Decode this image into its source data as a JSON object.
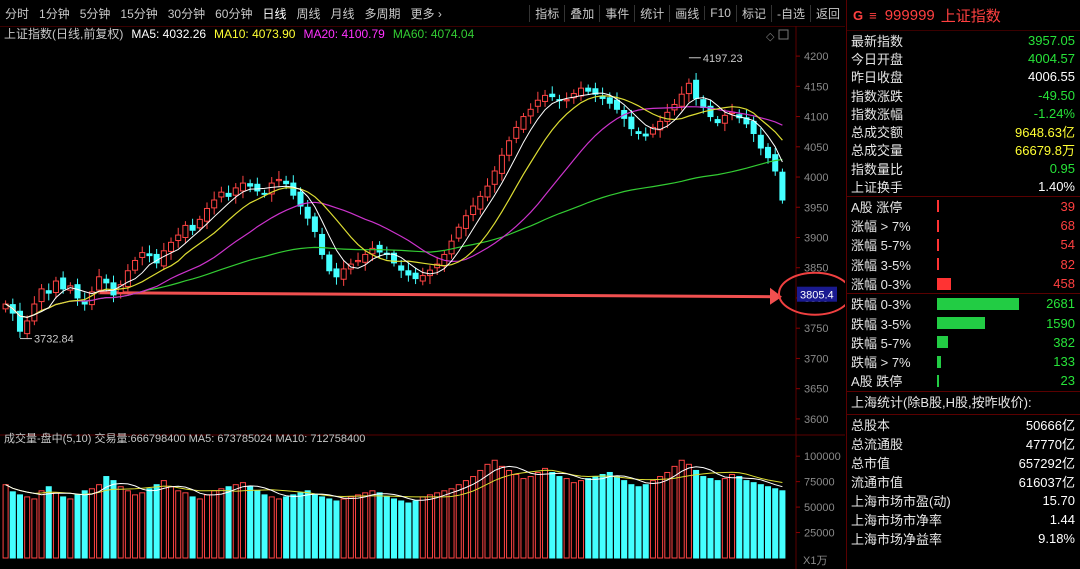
{
  "toolbar": {
    "left": [
      "分时",
      "1分钟",
      "5分钟",
      "15分钟",
      "30分钟",
      "60分钟",
      "日线",
      "周线",
      "月线",
      "多周期",
      "更多 ›"
    ],
    "active_index": 6,
    "right": [
      "指标",
      "叠加",
      "事件",
      "统计",
      "画线",
      "F10",
      "标记",
      "-自选",
      "返回"
    ]
  },
  "indicator_header": {
    "label": "上证指数(日线,前复权)",
    "ma5": "MA5: 4032.26",
    "ma10": "MA10: 4073.90",
    "ma20": "MA20: 4100.79",
    "ma60": "MA60: 4074.04",
    "colors": {
      "ma5": "#ffffff",
      "ma10": "#ffff33",
      "ma20": "#ff33ff",
      "ma60": "#33cc33"
    }
  },
  "volume_header": "成交量-盘中(5,10) 交易量:666798400 MA5: 673785024 MA10: 712758400",
  "price_ticks": [
    "4200",
    "4150",
    "4100",
    "4050",
    "4000",
    "3950",
    "3900",
    "3850",
    "3800",
    "3750",
    "3700",
    "3650",
    "3600"
  ],
  "volume_ticks": [
    "100000",
    "75000",
    "50000",
    "25000"
  ],
  "volume_unit": "X1万",
  "annotations": {
    "high_label": "4197.23",
    "low_label": "3732.84",
    "level_label": "3805.4"
  },
  "chart_data": {
    "type": "candlestick",
    "y_range": [
      3580,
      4220
    ],
    "level_line": 3805.4,
    "closes": [
      3790,
      3775,
      3745,
      3762,
      3790,
      3815,
      3808,
      3828,
      3815,
      3820,
      3800,
      3790,
      3810,
      3835,
      3825,
      3805,
      3822,
      3845,
      3862,
      3875,
      3870,
      3858,
      3878,
      3892,
      3904,
      3920,
      3912,
      3930,
      3948,
      3962,
      3975,
      3968,
      3982,
      3990,
      3985,
      3977,
      3972,
      3990,
      3996,
      3989,
      3970,
      3952,
      3932,
      3910,
      3872,
      3845,
      3835,
      3848,
      3856,
      3862,
      3872,
      3882,
      3876,
      3872,
      3858,
      3846,
      3838,
      3832,
      3837,
      3846,
      3856,
      3872,
      3894,
      3917,
      3936,
      3952,
      3968,
      3985,
      4010,
      4036,
      4060,
      4082,
      4100,
      4112,
      4127,
      4135,
      4133,
      4127,
      4128,
      4138,
      4147,
      4142,
      4137,
      4130,
      4122,
      4112,
      4097,
      4080,
      4072,
      4068,
      4082,
      4092,
      4107,
      4120,
      4137,
      4155,
      4130,
      4115,
      4100,
      4090,
      4102,
      4107,
      4098,
      4088,
      4072,
      4048,
      4032,
      4010,
      3962
    ],
    "volume_ma_note": "volume shown in 万手",
    "volumes": [
      72000,
      65000,
      62000,
      60000,
      58000,
      66000,
      70000,
      64000,
      60000,
      58000,
      62000,
      66000,
      68000,
      72000,
      80000,
      76000,
      70000,
      66000,
      62000,
      64000,
      68000,
      72000,
      76000,
      70000,
      66000,
      64000,
      60000,
      58000,
      62000,
      66000,
      68000,
      70000,
      72000,
      74000,
      70000,
      66000,
      62000,
      60000,
      58000,
      60000,
      62000,
      64000,
      66000,
      62000,
      60000,
      58000,
      56000,
      58000,
      60000,
      62000,
      64000,
      66000,
      64000,
      60000,
      58000,
      56000,
      54000,
      56000,
      60000,
      62000,
      64000,
      66000,
      68000,
      72000,
      76000,
      80000,
      86000,
      92000,
      96000,
      90000,
      86000,
      82000,
      78000,
      80000,
      84000,
      88000,
      84000,
      80000,
      78000,
      74000,
      76000,
      78000,
      80000,
      82000,
      84000,
      80000,
      76000,
      72000,
      70000,
      72000,
      76000,
      80000,
      84000,
      90000,
      96000,
      92000,
      86000,
      80000,
      78000,
      76000,
      78000,
      82000,
      80000,
      76000,
      74000,
      72000,
      70000,
      68000,
      66000
    ]
  },
  "sidebar": {
    "g": "G",
    "eq": "≡",
    "code": "999999",
    "name": "上证指数",
    "quote": [
      {
        "label": "最新指数",
        "value": "3957.05",
        "cls": "val-down"
      },
      {
        "label": "今日开盘",
        "value": "4004.57",
        "cls": "val-down"
      },
      {
        "label": "昨日收盘",
        "value": "4006.55",
        "cls": "val-white"
      },
      {
        "label": "指数涨跌",
        "value": "-49.50",
        "cls": "val-down"
      },
      {
        "label": "指数涨幅",
        "value": "-1.24%",
        "cls": "val-down"
      },
      {
        "label": "总成交额",
        "value": "9648.63亿",
        "cls": "val-yellow"
      },
      {
        "label": "总成交量",
        "value": "66679.8万",
        "cls": "val-yellow"
      },
      {
        "label": "指数量比",
        "value": "0.95",
        "cls": "val-down"
      },
      {
        "label": "上证换手",
        "value": "1.40%",
        "cls": "val-white"
      }
    ],
    "breadth_up": [
      {
        "label": "A股 涨停",
        "value": "39",
        "frac": 0.02
      },
      {
        "label": "涨幅 > 7%",
        "value": "68",
        "frac": 0.02
      },
      {
        "label": "涨幅 5-7%",
        "value": "54",
        "frac": 0.02
      },
      {
        "label": "涨幅 3-5%",
        "value": "82",
        "frac": 0.03
      },
      {
        "label": "涨幅 0-3%",
        "value": "458",
        "frac": 0.17
      }
    ],
    "breadth_down": [
      {
        "label": "跌幅 0-3%",
        "value": "2681",
        "frac": 1.0
      },
      {
        "label": "跌幅 3-5%",
        "value": "1590",
        "frac": 0.59
      },
      {
        "label": "跌幅 5-7%",
        "value": "382",
        "frac": 0.14
      },
      {
        "label": "跌幅 > 7%",
        "value": "133",
        "frac": 0.05
      },
      {
        "label": "A股 跌停",
        "value": "23",
        "frac": 0.01
      }
    ],
    "sh_title": "上海统计(除B股,H股,按昨收价):",
    "sh_stats": [
      {
        "label": "总股本",
        "value": "50666亿"
      },
      {
        "label": "总流通股",
        "value": "47770亿"
      },
      {
        "label": "总市值",
        "value": "657292亿"
      },
      {
        "label": "流通市值",
        "value": "616037亿"
      },
      {
        "label": "上海市场市盈(动)",
        "value": "15.70"
      },
      {
        "label": "上海市场市净率",
        "value": "1.44"
      },
      {
        "label": "上海市场净益率",
        "value": "9.18%"
      }
    ]
  }
}
